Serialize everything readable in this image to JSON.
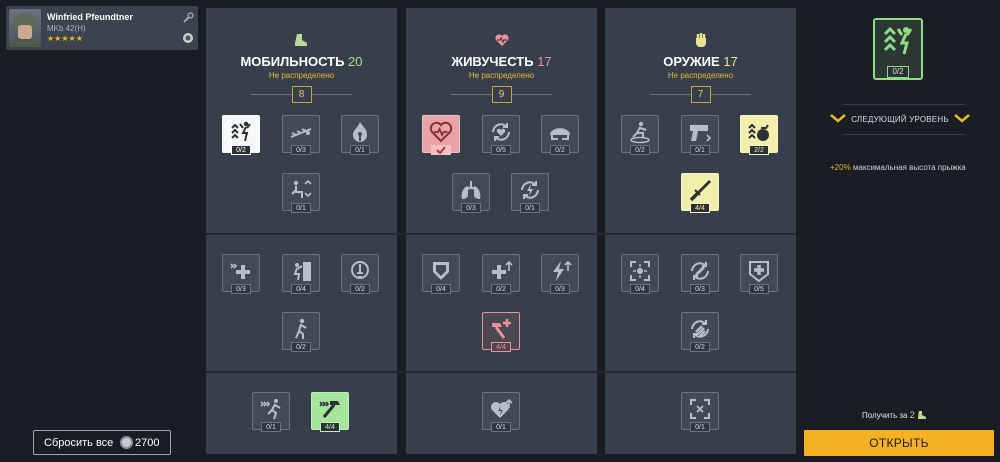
{
  "soldier": {
    "name": "Winfried Pfeundtner",
    "weapon": "MKb 42(H)",
    "stars": "★★★★★"
  },
  "columns": [
    {
      "title": "МОБИЛЬНОСТЬ",
      "value": "20",
      "unallocated_label": "Не распределено",
      "points": "8"
    },
    {
      "title": "ЖИВУЧЕСТЬ",
      "value": "17",
      "unallocated_label": "Не распределено",
      "points": "9"
    },
    {
      "title": "ОРУЖИЕ",
      "value": "17",
      "unallocated_label": "Не распределено",
      "points": "7"
    }
  ],
  "skills": {
    "mobility": [
      "0/2",
      "0/3",
      "0/1",
      "0/1",
      "0/3",
      "0/4",
      "0/2",
      "0/2",
      "0/1",
      "4/4"
    ],
    "vitality": [
      "",
      "0/5",
      "0/2",
      "0/3",
      "0/1",
      "0/4",
      "0/2",
      "0/3",
      "4/4",
      "0/1"
    ],
    "weapon": [
      "0/2",
      "0/1",
      "2/2",
      "4/4",
      "0/4",
      "0/3",
      "0/5",
      "0/2",
      "0/1"
    ]
  },
  "reset": {
    "label": "Сбросить все",
    "amount": "2700"
  },
  "preview": {
    "count": "0/2",
    "next_level_label": "СЛЕДУЮЩИЙ УРОВЕНЬ",
    "bonus_highlight": "+20%",
    "bonus_text": " максимальная высота прыжка",
    "obtain_label": "Получить за",
    "obtain_cost": "2",
    "open_label": "ОТКРЫТЬ"
  },
  "colors": {
    "mobility_accent": "#b9d996",
    "vitality_accent": "#f08f96",
    "weapon_accent": "#ede28f",
    "gold": "#e8b72c",
    "open_button": "#f6b024"
  }
}
